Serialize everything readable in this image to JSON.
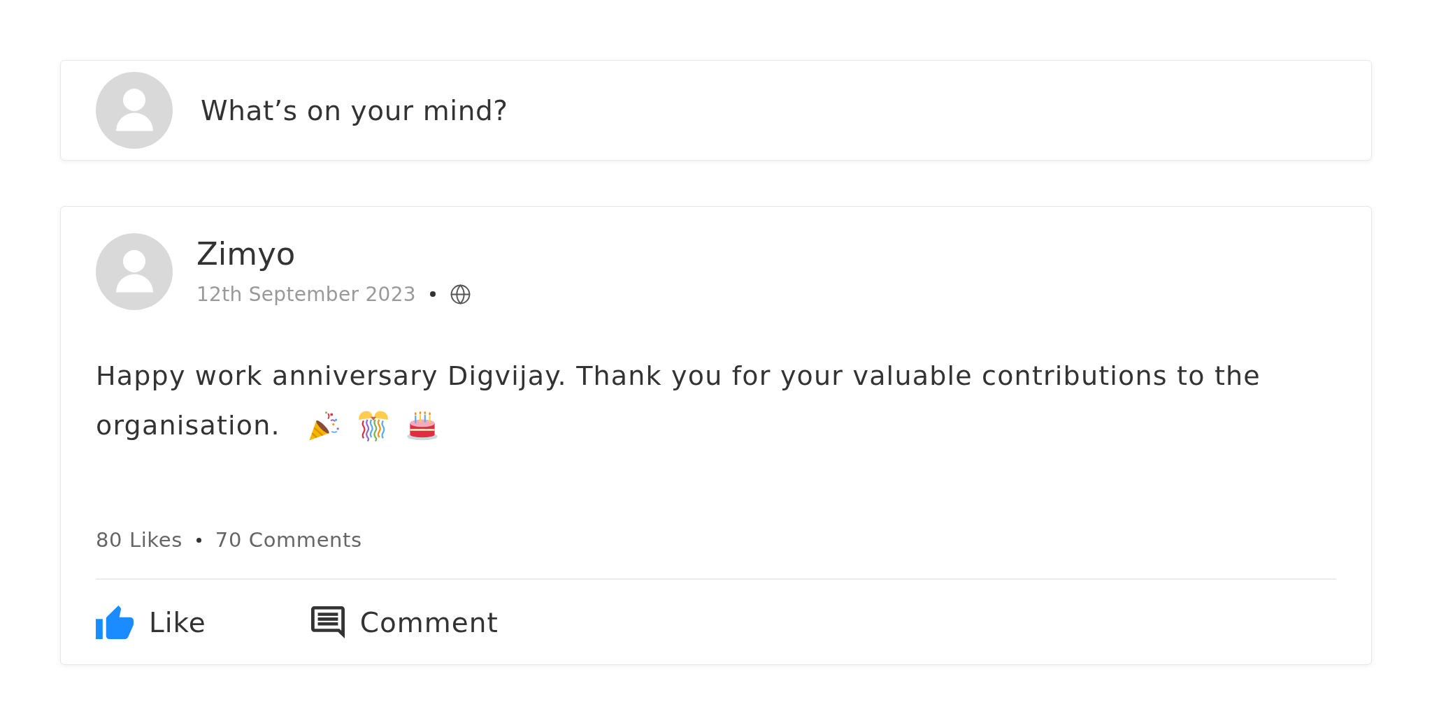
{
  "composer": {
    "placeholder": "What’s on your mind?"
  },
  "post": {
    "author": "Zimyo",
    "date": "12th September 2023",
    "text_lines": [
      "Happy work anniversary Digvijay. Thank you for your valuable contributions to the",
      "organisation."
    ],
    "emojis": [
      {
        "kind": "party_popper"
      },
      {
        "kind": "confetti_ball"
      },
      {
        "kind": "birthday_cake"
      }
    ],
    "likes": "80 Likes",
    "comments": "70 Comments",
    "liked": true,
    "actions": [
      {
        "kind": "like",
        "label": "Like"
      },
      {
        "kind": "comment",
        "label": "Comment"
      }
    ]
  }
}
